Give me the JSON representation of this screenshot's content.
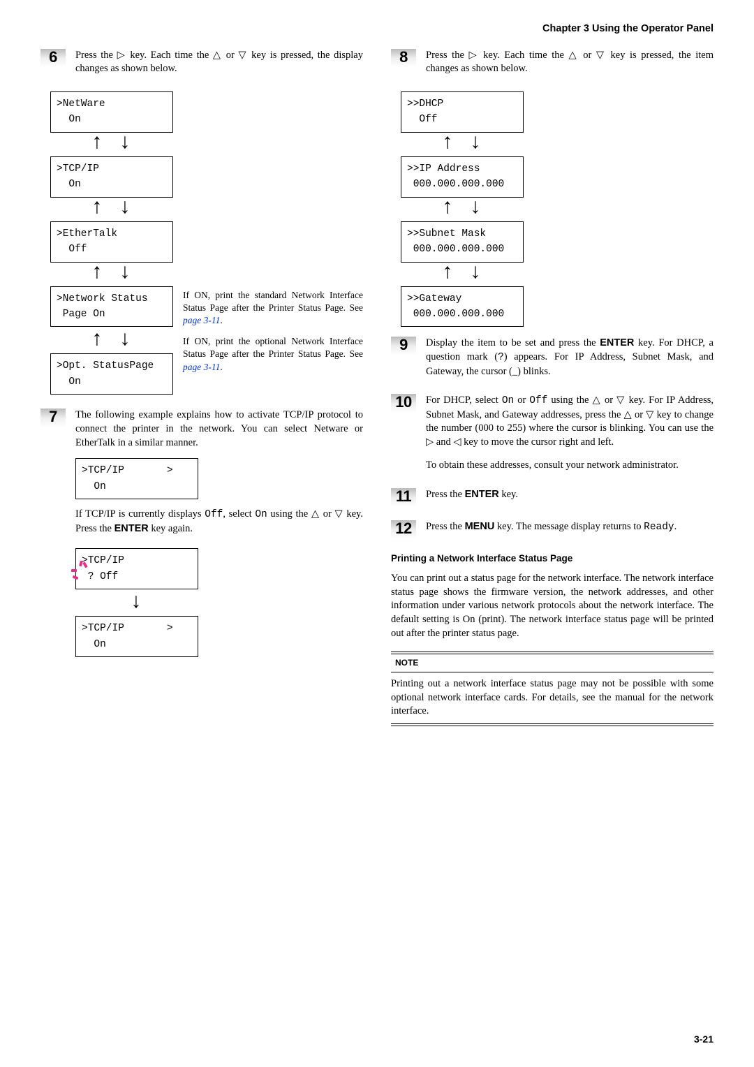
{
  "header": {
    "chapter": "Chapter 3  Using the Operator Panel"
  },
  "glyph": {
    "right": "▷",
    "up": "△",
    "down": "▽",
    "left": "◁",
    "arrow_up": "↑",
    "arrow_down": "↓",
    "updown": "↑ ↓"
  },
  "left": {
    "step6": {
      "num": "6",
      "text_a": "Press the ",
      "text_b": " key. Each time the ",
      "text_c": " or ",
      "text_d": " key is pressed, the display changes as shown below."
    },
    "lcd": {
      "netware": ">NetWare\n  On",
      "tcpip": ">TCP/IP\n  On",
      "ethertalk": ">EtherTalk\n  Off",
      "networkstatus": ">Network Status\n Page On",
      "optstatus": ">Opt. StatusPage\n  On"
    },
    "annot1_a": "If ON, print the standard Network Interface Status Page after the Printer Status Page. See ",
    "annot1_link": "page 3-11",
    "annot1_end": ".",
    "annot2_a": "If ON, print the optional Network Interface Status Page after the Printer Status Page. See ",
    "annot2_link": "page 3-11",
    "annot2_end": ".",
    "step7": {
      "num": "7",
      "p1": "The following example explains how to activate TCP/IP protocol to connect the printer in the network. You can select Netware or EtherTalk in a similar manner.",
      "lcd1": ">TCP/IP       >\n  On",
      "p2_a": "If TCP/IP is currently displays ",
      "p2_off": "Off",
      "p2_b": ", select ",
      "p2_on": "On",
      "p2_c": " using the ",
      "p2_d": " or ",
      "p2_e": " key. Press the ",
      "p2_enter": "ENTER",
      "p2_f": " key again.",
      "lcd2": ">TCP/IP\n ? Off",
      "lcd3": ">TCP/IP       >\n  On"
    }
  },
  "right": {
    "step8": {
      "num": "8",
      "text_a": "Press the ",
      "text_b": " key. Each time the ",
      "text_c": " or ",
      "text_d": " key is pressed, the item changes as shown below."
    },
    "lcd": {
      "dhcp": ">>DHCP\n  Off",
      "ipaddr": ">>IP Address\n 000.000.000.000",
      "subnet": ">>Subnet Mask\n 000.000.000.000",
      "gateway": ">>Gateway\n 000.000.000.000"
    },
    "step9": {
      "num": "9",
      "text_a": "Display the item to be set and press the ",
      "enter": "ENTER",
      "text_b": " key. For DHCP, a question mark (",
      "qm": "?",
      "text_c": ") appears. For IP Address, Subnet Mask, and Gateway, the cursor (_) blinks."
    },
    "step10": {
      "num": "10",
      "text_a": "For DHCP, select ",
      "on": "On",
      "text_b": " or ",
      "off": "Off",
      "text_c": " using the ",
      "text_d": " or ",
      "text_e": " key. For IP Address, Subnet Mask, and Gateway addresses, press the ",
      "text_f": " or ",
      "text_g": " key to change the number (000 to 255) where the cursor is blinking. You can use the ",
      "text_h": " and ",
      "text_i": " key to move the cursor right and left.",
      "para2": "To obtain these addresses, consult your network administrator."
    },
    "step11": {
      "num": "11",
      "text_a": "Press the ",
      "enter": "ENTER",
      "text_b": " key."
    },
    "step12": {
      "num": "12",
      "text_a": "Press the ",
      "menu": "MENU",
      "text_b": " key. The message display returns to ",
      "ready": "Ready",
      "text_c": "."
    },
    "section_hdr": "Printing a Network Interface Status Page",
    "section_body": "You can print out a status page for the network interface. The network interface status page shows the firmware version, the network addresses, and other information under various network protocols about the network interface. The default setting is On (print). The network interface status page will be printed out after the printer status page.",
    "note_label": "NOTE",
    "note_body": "Printing out a network interface status page may not be possible with some optional network interface cards. For details, see the manual for the network interface."
  },
  "footer": {
    "page": "3-21"
  }
}
